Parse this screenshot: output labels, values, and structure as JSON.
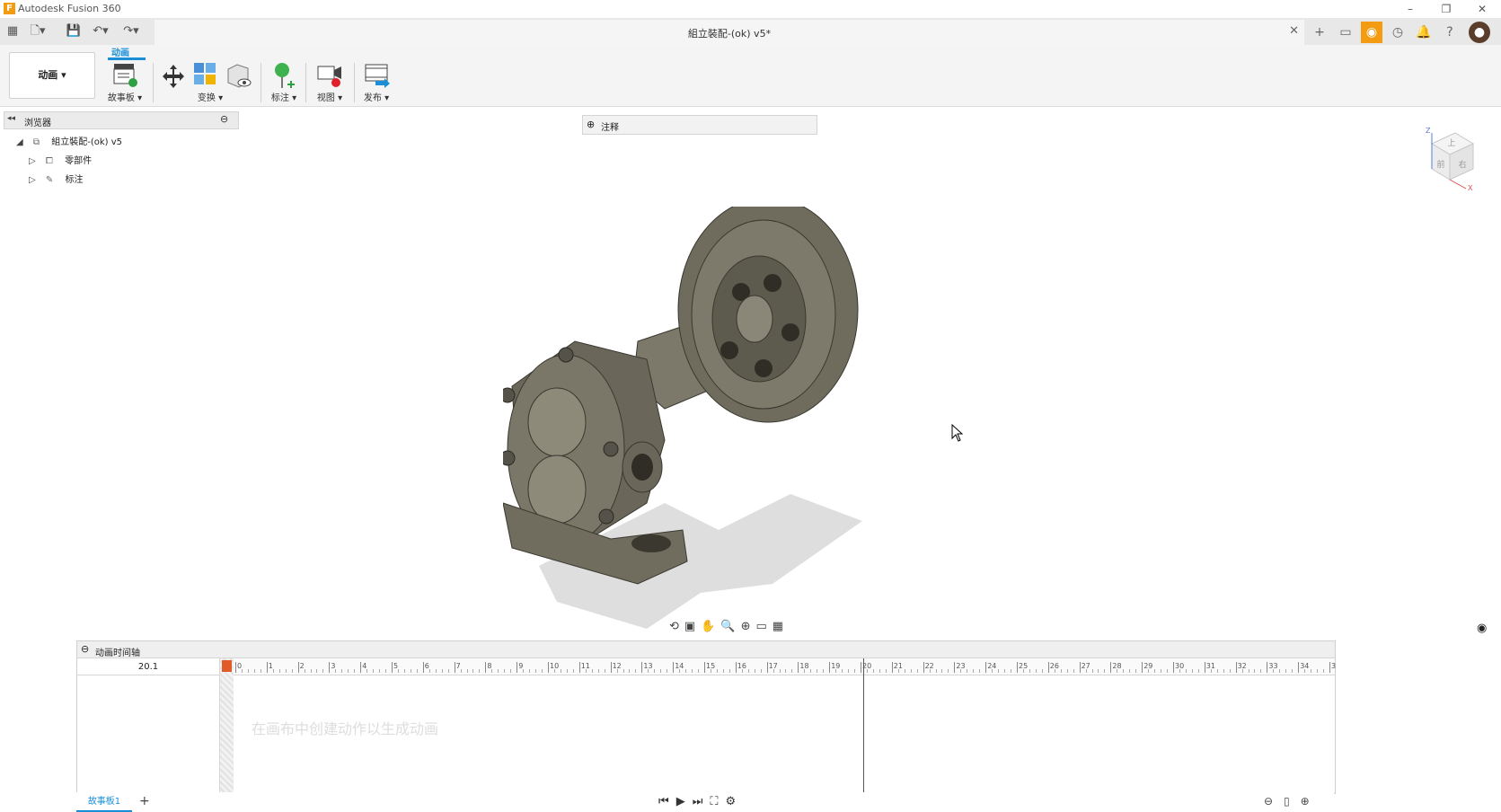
{
  "app_title": "Autodesk Fusion 360",
  "document_title": "組立裝配-(ok) v5*",
  "workspace": "动画",
  "ribbon_tab": "动画",
  "toolbar": {
    "storyboard": "故事板",
    "transform": "变换",
    "annotation": "标注",
    "view": "视图",
    "publish": "发布"
  },
  "browser": {
    "title": "浏览器",
    "root": "組立裝配-(ok) v5",
    "items": [
      "零部件",
      "标注"
    ]
  },
  "comments": {
    "title": "注释"
  },
  "timeline": {
    "title": "动画时间轴",
    "time_value": "20.1",
    "hint": "在画布中创建动作以生成动画",
    "ticks": [
      "0",
      "1",
      "2",
      "3",
      "4",
      "5",
      "6",
      "7",
      "8",
      "9",
      "10",
      "11",
      "12",
      "13",
      "14",
      "15",
      "16",
      "17",
      "18",
      "19",
      "20",
      "21",
      "22",
      "23",
      "24",
      "25",
      "26",
      "27",
      "28",
      "29",
      "30",
      "31",
      "32",
      "33",
      "34",
      "3"
    ],
    "playhead_value": 20.1
  },
  "storyboard_tab": "故事板1",
  "viewcube": {
    "top": "上",
    "front": "前",
    "right": "右",
    "axis_z": "Z",
    "axis_x": "X"
  },
  "colors": {
    "accent": "#1a8fd8",
    "orange": "#f39c12"
  }
}
